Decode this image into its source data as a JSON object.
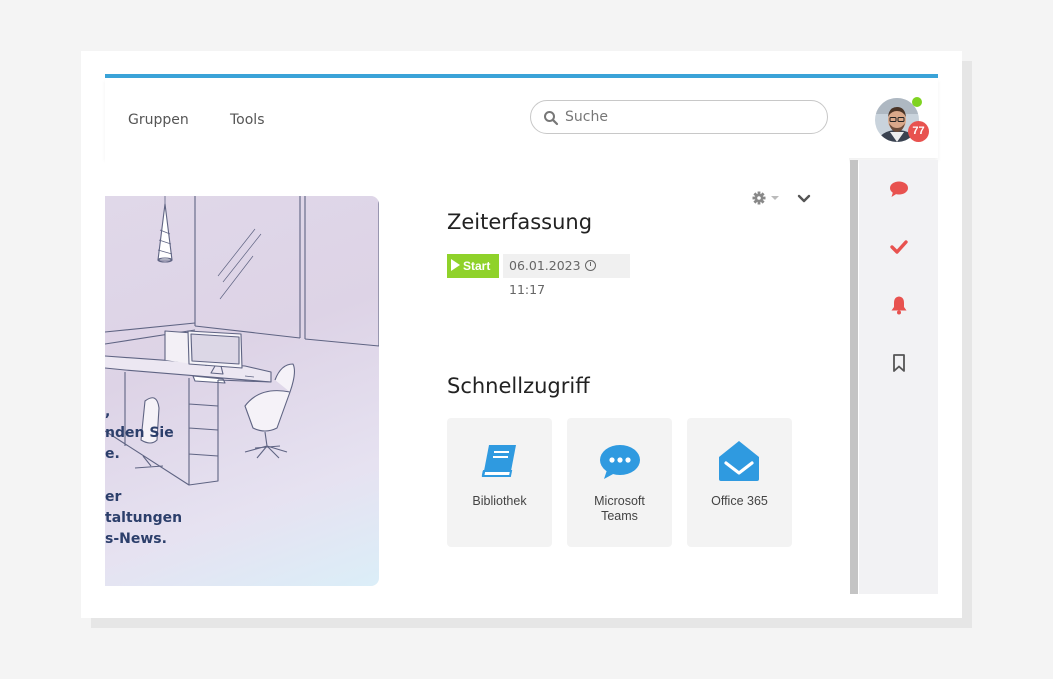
{
  "nav": {
    "items": [
      {
        "label": "Gruppen"
      },
      {
        "label": "Tools"
      }
    ]
  },
  "search": {
    "placeholder": "Suche",
    "value": ""
  },
  "user": {
    "notification_count": "77",
    "status": "online"
  },
  "hero": {
    "text_block_1": ",\nnden Sie\ne.",
    "text_block_2": "er\ntaltungen\ns-News."
  },
  "time_tracking": {
    "title": "Zeiterfassung",
    "start_label": "Start",
    "date": "06.01.2023",
    "time": "11:17"
  },
  "quick_access": {
    "title": "Schnellzugriff",
    "tiles": [
      {
        "label": "Bibliothek",
        "icon": "book-icon"
      },
      {
        "label": "Microsoft\nTeams",
        "icon": "chat-bubble-icon"
      },
      {
        "label": "Office 365",
        "icon": "envelope-icon"
      }
    ]
  },
  "right_rail": [
    {
      "icon": "comment-icon"
    },
    {
      "icon": "check-icon"
    },
    {
      "icon": "bell-icon"
    },
    {
      "icon": "bookmark-icon"
    }
  ],
  "colors": {
    "accent": "#3aa3d8",
    "start_green": "#8fd22a",
    "rail_red": "#e8524f",
    "tile_blue": "#2f9ae0",
    "online": "#7fd321"
  }
}
